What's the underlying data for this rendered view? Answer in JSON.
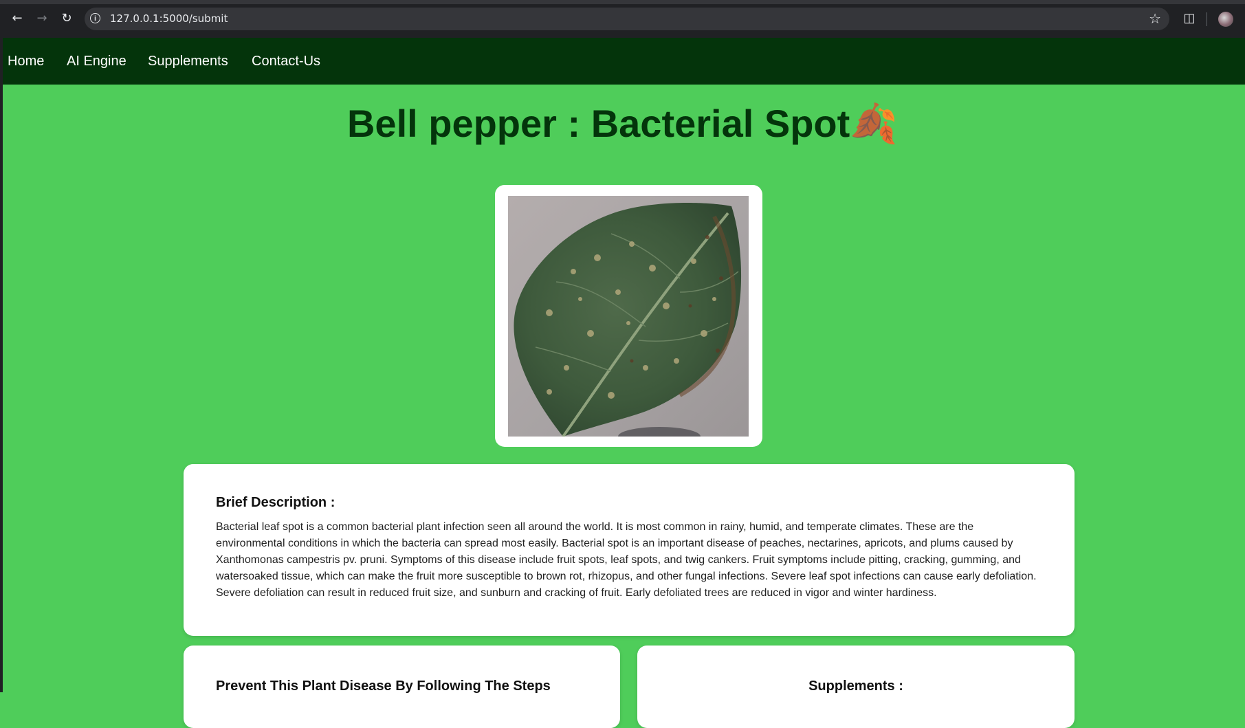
{
  "browser": {
    "url": "127.0.0.1:5000/submit",
    "back_icon": "arrow-left",
    "forward_icon": "arrow-right",
    "reload_icon": "reload",
    "info_icon": "info-circle",
    "bookmark_icon": "star",
    "extensions_icon": "puzzle-piece"
  },
  "nav": {
    "items": [
      {
        "label": "Home"
      },
      {
        "label": "AI Engine"
      },
      {
        "label": "Supplements"
      },
      {
        "label": "Contact-Us"
      }
    ]
  },
  "main": {
    "title": "Bell pepper : Bacterial Spot",
    "title_icon": "fallen-leaf",
    "title_emoji": "🍂",
    "description_heading": "Brief Description :",
    "description": "Bacterial leaf spot is a common bacterial plant infection seen all around the world. It is most common in rainy, humid, and temperate climates. These are the environmental conditions in which the bacteria can spread most easily. Bacterial spot is an important disease of peaches, nectarines, apricots, and plums caused by Xanthomonas campestris pv. pruni. Symptoms of this disease include fruit spots, leaf spots, and twig cankers. Fruit symptoms include pitting, cracking, gumming, and watersoaked tissue, which can make the fruit more susceptible to brown rot, rhizopus, and other fungal infections. Severe leaf spot infections can cause early defoliation. Severe defoliation can result in reduced fruit size, and sunburn and cracking of fruit. Early defoliated trees are reduced in vigor and winter hardiness.",
    "prevent_heading": "Prevent This Plant Disease By Following The Steps",
    "supplements_heading": "Supplements :"
  },
  "colors": {
    "page_background": "#4fcd5a",
    "nav_background": "#04340b",
    "title_color": "#04340b",
    "card_background": "#ffffff"
  }
}
